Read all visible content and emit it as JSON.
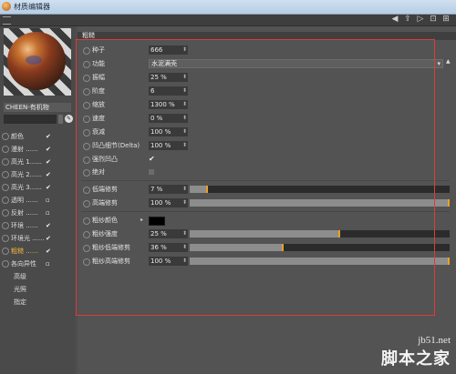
{
  "window": {
    "title": "材质编辑器"
  },
  "material": {
    "name": "CHEEN-有机物"
  },
  "sidebar": {
    "channels": [
      {
        "label": "颜色",
        "checked": true,
        "active": false
      },
      {
        "label": "漫射 ......",
        "checked": true,
        "active": false
      },
      {
        "label": "高光 1......",
        "checked": true,
        "active": false
      },
      {
        "label": "高光 2......",
        "checked": true,
        "active": false
      },
      {
        "label": "高光 3......",
        "checked": true,
        "active": false
      },
      {
        "label": "透明 ......",
        "checked": false,
        "active": false
      },
      {
        "label": "反射 ......",
        "checked": false,
        "active": false
      },
      {
        "label": "环境 ......",
        "checked": true,
        "active": false
      },
      {
        "label": "环境光 ......",
        "checked": true,
        "active": false
      },
      {
        "label": "粗糙 ......",
        "checked": true,
        "active": true
      },
      {
        "label": "各向异性",
        "checked": false,
        "active": false
      }
    ],
    "sub_items": [
      "高级",
      "光照",
      "指定"
    ]
  },
  "panel": {
    "section": "粗糙",
    "rows": {
      "seed": {
        "label": "种子",
        "value": "666"
      },
      "function": {
        "label": "功能",
        "value": "水泥满壳"
      },
      "amplitude": {
        "label": "振幅",
        "value": "25 %"
      },
      "octaves": {
        "label": "阶度",
        "value": "6"
      },
      "scale": {
        "label": "缩放",
        "value": "1300 %"
      },
      "speed": {
        "label": "速度",
        "value": "0 %"
      },
      "attenuation": {
        "label": "衰减",
        "value": "100 %"
      },
      "delta": {
        "label": "凹凸细节(Delta)",
        "value": "100 %"
      },
      "strong_bump": {
        "label": "强烈凹凸",
        "checked": true
      },
      "absolute": {
        "label": "绝对",
        "checked": false
      },
      "low_clip": {
        "label": "低端修剪",
        "value": "7 %",
        "fraction": 0.07
      },
      "high_clip": {
        "label": "高端修剪",
        "value": "100 %",
        "fraction": 1.0
      },
      "rough_color": {
        "label": "粗纱颜色",
        "color": "#000000"
      },
      "rough_strength": {
        "label": "粗纱强度",
        "value": "25 %",
        "fraction": 0.58
      },
      "rough_low_clip": {
        "label": "粗纱低端修剪",
        "value": "36 %",
        "fraction": 0.36
      },
      "rough_high_clip": {
        "label": "粗纱高端修剪",
        "value": "100 %",
        "fraction": 1.0
      }
    }
  },
  "watermark": {
    "url": "jb51.net",
    "brand": "脚本之家"
  },
  "colors": {
    "accent": "#e9a125",
    "highlight_outline": "#e23a3a",
    "active_channel": "#f0b33a"
  }
}
